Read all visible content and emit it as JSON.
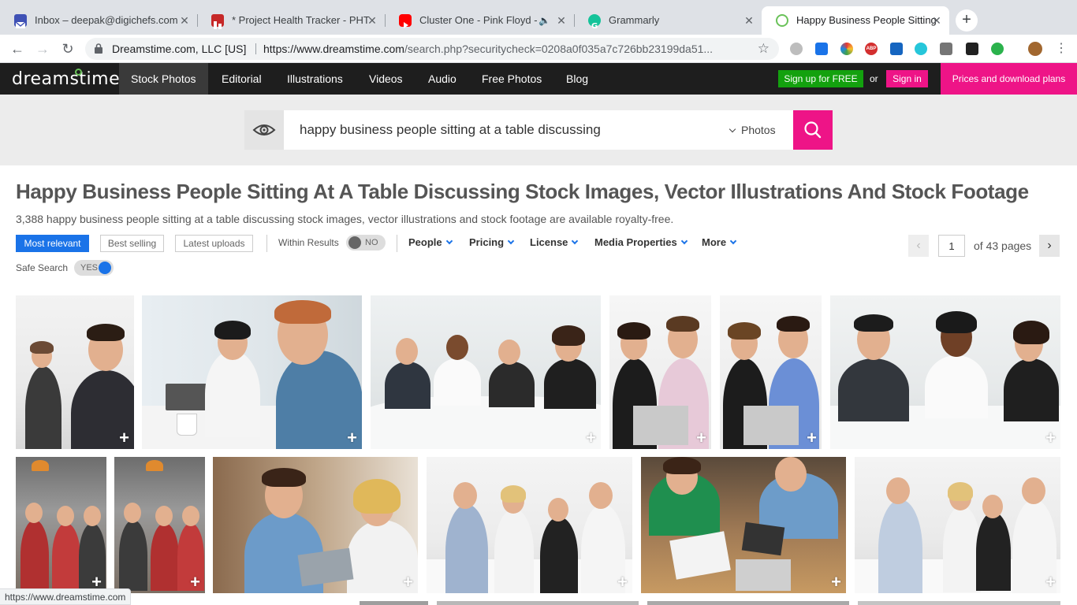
{
  "browser": {
    "tabs": [
      {
        "title": "Inbox – deepak@digichefs.com",
        "favicon": "mail-icon"
      },
      {
        "title": "* Project Health Tracker - PHT",
        "favicon": "tracker-icon"
      },
      {
        "title": "Cluster One - Pink Floyd -",
        "favicon": "youtube-icon",
        "audio": "speaker-icon"
      },
      {
        "title": "Grammarly",
        "favicon": "grammarly-icon"
      },
      {
        "title": "Happy Business People Sitting",
        "favicon": "dreamstime-icon",
        "active": true
      }
    ],
    "new_tab_label": "+",
    "omnibox": {
      "site": "Dreamstime.com, LLC [US]",
      "url_host": "https://www.dreamstime.com",
      "url_path": "/search.php?securitycheck=0208a0f035a7c726bb23199da51..."
    },
    "status_url": "https://www.dreamstime.com"
  },
  "site": {
    "logo": "dreamstime",
    "nav": [
      "Stock Photos",
      "Editorial",
      "Illustrations",
      "Videos",
      "Audio",
      "Free Photos",
      "Blog"
    ],
    "active_nav": "Stock Photos",
    "signup_label": "Sign up for FREE",
    "or_label": "or",
    "signin_label": "Sign in",
    "prices_label": "Prices and download plans",
    "brand_pink": "#ee1487",
    "brand_green": "#13a10e"
  },
  "search": {
    "query": "happy business people sitting at a table discussing",
    "type": "Photos"
  },
  "results": {
    "title": "Happy Business People Sitting At A Table Discussing Stock Images, Vector Illustrations And Stock Footage",
    "subtitle": "3,388 happy business people sitting at a table discussing stock images, vector illustrations and stock footage are available royalty-free."
  },
  "filters": {
    "sort": [
      "Most relevant",
      "Best selling",
      "Latest uploads"
    ],
    "active_sort": "Most relevant",
    "within_results_label": "Within Results",
    "within_results_value": "NO",
    "dropdowns": [
      "People",
      "Pricing",
      "License",
      "Media Properties",
      "More"
    ],
    "safe_search_label": "Safe Search",
    "safe_search_value": "YES",
    "page": "1",
    "of_pages": "of 43 pages"
  },
  "plus_label": "+"
}
